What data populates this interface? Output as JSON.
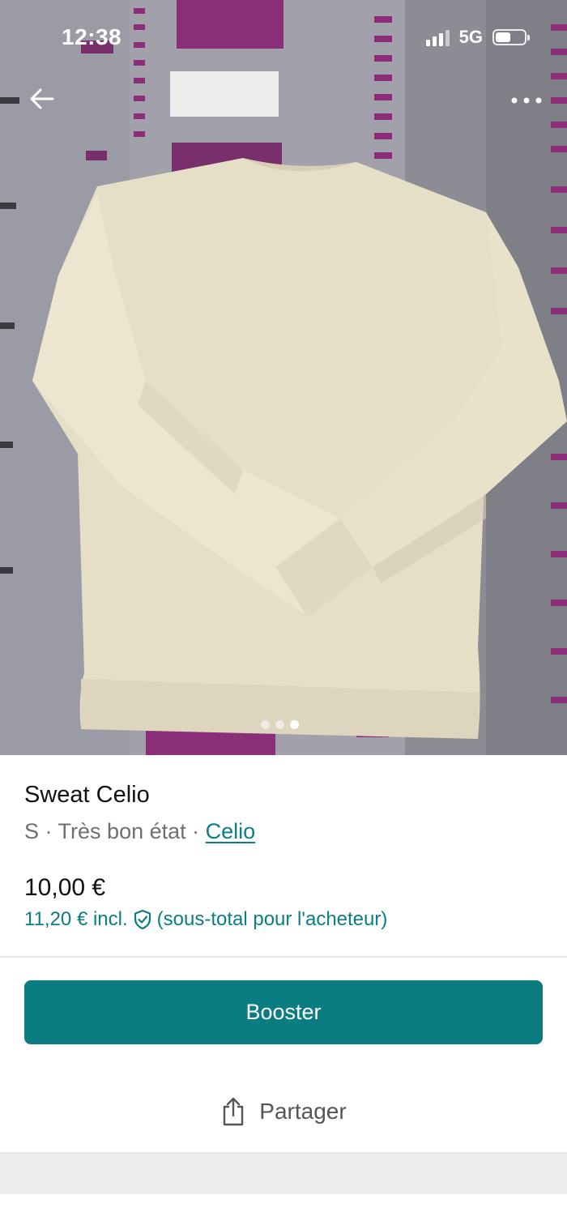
{
  "status_bar": {
    "time": "12:38",
    "network": "5G"
  },
  "top_bar": {
    "back_icon": "arrow-left-icon",
    "more_icon": "more-horizontal-icon"
  },
  "gallery": {
    "image_count": 3,
    "active_index": 2
  },
  "item": {
    "title": "Sweat Celio",
    "size": "S",
    "separator": "·",
    "condition": "Très bon état",
    "brand": "Celio",
    "price": "10,00 €",
    "price_incl": "11,20 € incl.",
    "price_incl_note": "(sous-total pour l'acheteur)",
    "protection_icon": "shield-check-icon"
  },
  "actions": {
    "boost_label": "Booster",
    "share_label": "Partager",
    "share_icon": "share-icon"
  },
  "colors": {
    "accent": "#0b7c82",
    "link": "#0a7d85"
  }
}
